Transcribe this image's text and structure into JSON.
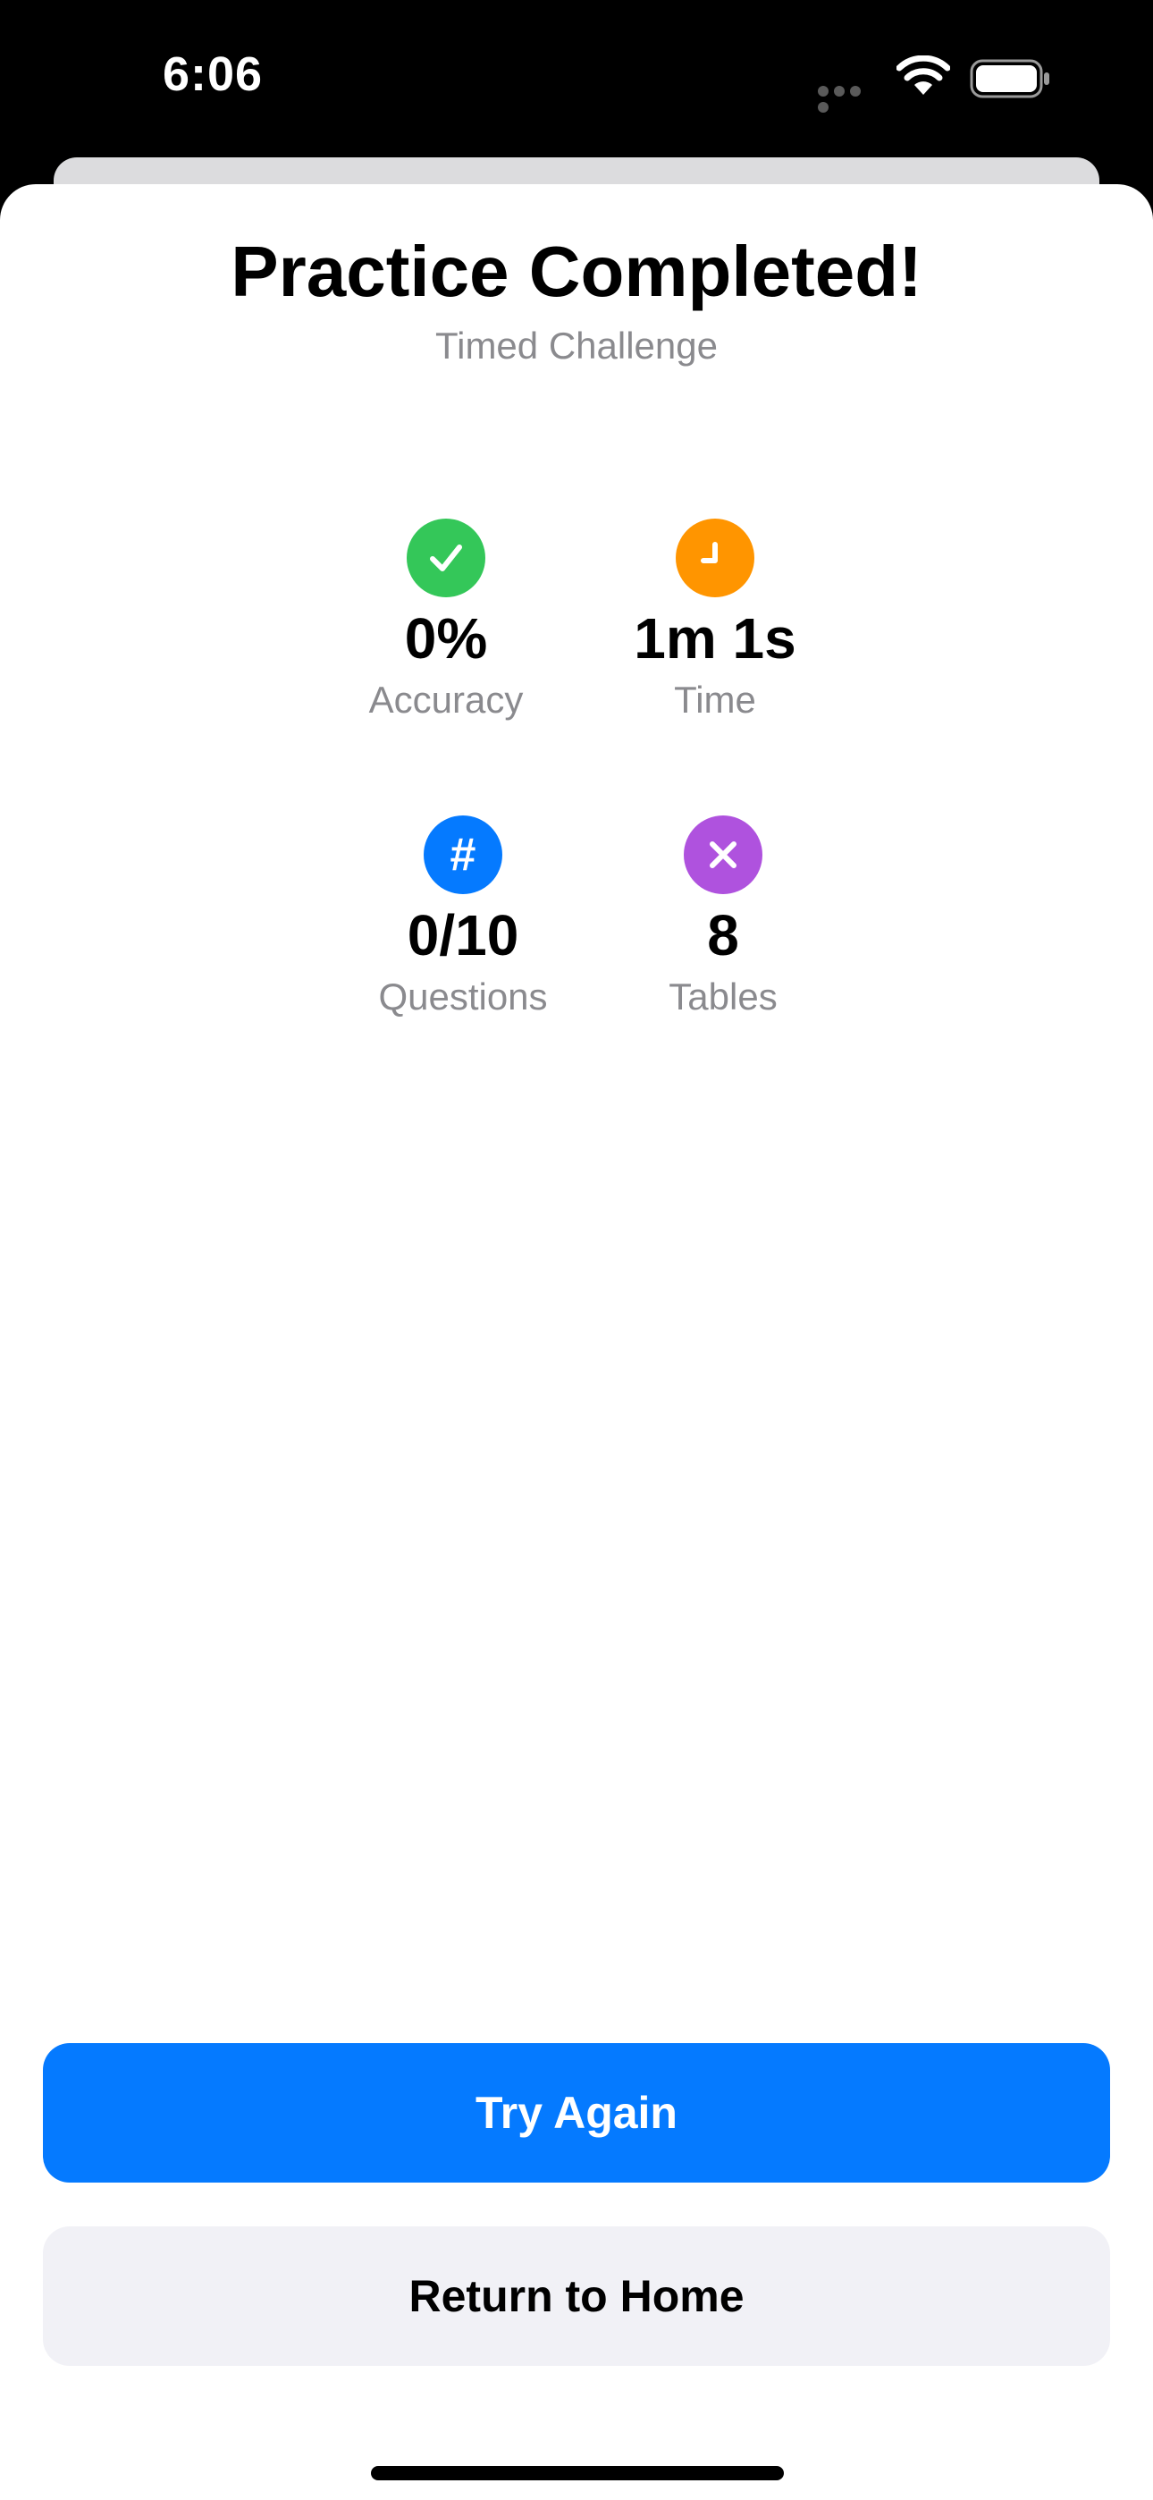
{
  "status_bar": {
    "time": "6:06"
  },
  "header": {
    "title": "Practice Completed!",
    "subtitle": "Timed Challenge"
  },
  "stats": [
    {
      "icon": "checkmark-icon",
      "color": "#34c759",
      "value": "0%",
      "label": "Accuracy"
    },
    {
      "icon": "clock-icon",
      "color": "#ff9500",
      "value": "1m 1s",
      "label": "Time"
    },
    {
      "icon": "hash-icon",
      "color": "#057aff",
      "value": "0/10",
      "label": "Questions",
      "glyph": "#"
    },
    {
      "icon": "multiply-icon",
      "color": "#af52de",
      "value": "8",
      "label": "Tables"
    }
  ],
  "actions": {
    "try_again": "Try Again",
    "return_home": "Return to Home"
  },
  "colors": {
    "accent": "#057aff",
    "secondary_bg": "#f1f1f6",
    "muted_text": "#8a8a8e"
  }
}
